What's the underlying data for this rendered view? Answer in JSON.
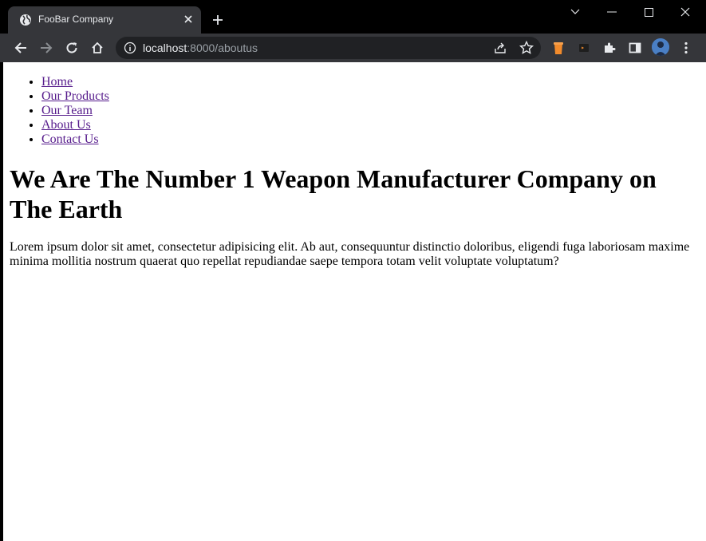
{
  "browser": {
    "tab": {
      "title": "FooBar Company"
    },
    "address": {
      "host": "localhost",
      "path": ":8000/aboutus"
    }
  },
  "page": {
    "nav": [
      {
        "label": "Home"
      },
      {
        "label": "Our Products"
      },
      {
        "label": "Our Team"
      },
      {
        "label": "About Us"
      },
      {
        "label": "Contact Us"
      }
    ],
    "heading": "We Are The Number 1 Weapon Manufacturer Company on The Earth",
    "paragraph": "Lorem ipsum dolor sit amet, consectetur adipisicing elit. Ab aut, consequuntur distinctio doloribus, eligendi fuga laboriosam maxime minima mollitia nostrum quaerat quo repellat repudiandae saepe tempora totam velit voluptate voluptatum?"
  },
  "colors": {
    "tab_bar": "#000000",
    "toolbar": "#35363a",
    "omnibox": "#202124",
    "link_visited": "#551a8b"
  }
}
